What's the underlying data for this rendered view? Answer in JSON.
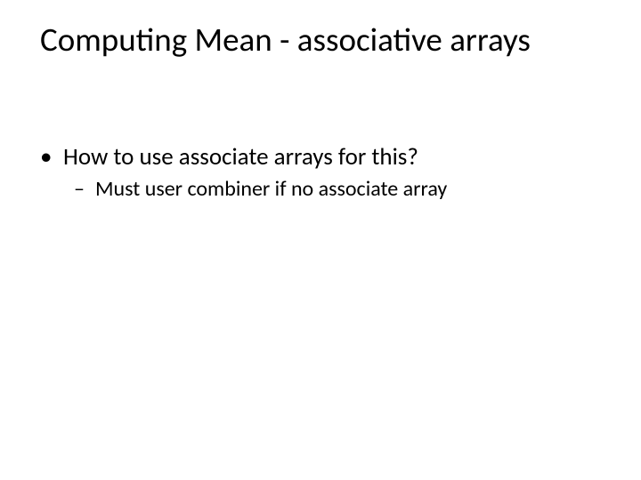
{
  "title": "Computing Mean - associative arrays",
  "bullets": {
    "item1": {
      "marker": "•",
      "text": "How to use associate arrays for this?"
    },
    "sub1": {
      "marker": "–",
      "text": "Must user combiner if no associate array"
    }
  }
}
